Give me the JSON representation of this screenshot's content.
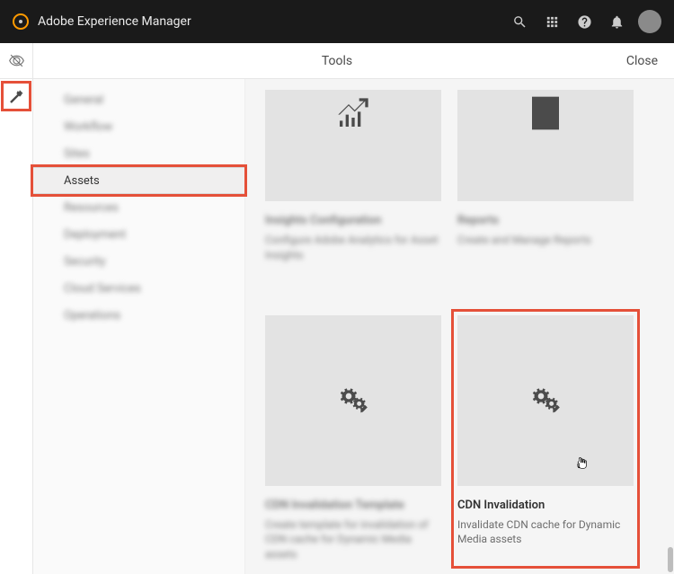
{
  "header": {
    "brand": "Adobe Experience Manager"
  },
  "toolsbar": {
    "title": "Tools",
    "close": "Close"
  },
  "nav": {
    "items": [
      {
        "label": "General"
      },
      {
        "label": "Workflow"
      },
      {
        "label": "Sites"
      },
      {
        "label": "Assets",
        "selected": true
      },
      {
        "label": "Resources"
      },
      {
        "label": "Deployment"
      },
      {
        "label": "Security"
      },
      {
        "label": "Cloud Services"
      },
      {
        "label": "Operations"
      }
    ]
  },
  "cards": {
    "row1": [
      {
        "title": "Insights Configuration",
        "desc": "Configure Adobe Analytics for Asset Insights"
      },
      {
        "title": "Reports",
        "desc": "Create and Manage Reports"
      }
    ],
    "row2": [
      {
        "title": "CDN Invalidation Template",
        "desc": "Create template for invalidation of CDN cache for Dynamic Media assets"
      },
      {
        "title": "CDN Invalidation",
        "desc": "Invalidate CDN cache for Dynamic Media assets"
      }
    ]
  }
}
